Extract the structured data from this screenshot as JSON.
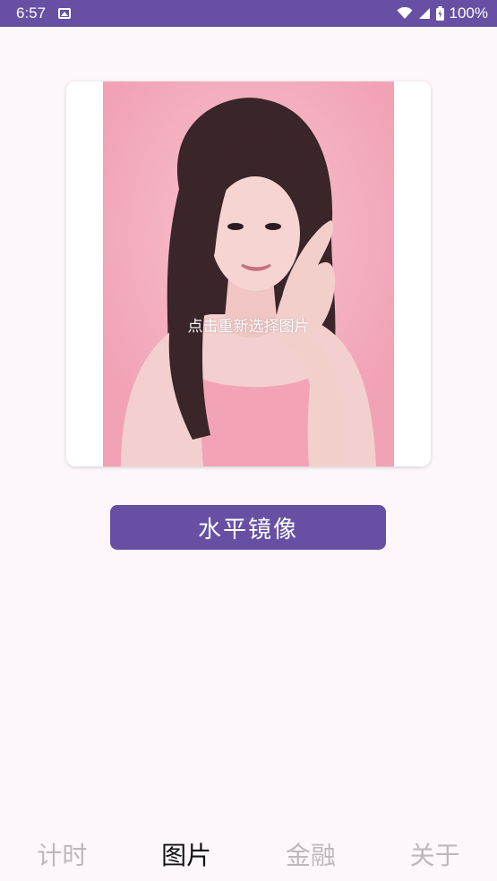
{
  "status_bar": {
    "time": "6:57",
    "battery": "100%"
  },
  "image_card": {
    "hint": "点击重新选择图片"
  },
  "mirror_button": {
    "label": "水平镜像"
  },
  "bottom_nav": {
    "items": [
      {
        "label": "计时",
        "active": false
      },
      {
        "label": "图片",
        "active": true
      },
      {
        "label": "金融",
        "active": false
      },
      {
        "label": "关于",
        "active": false
      }
    ]
  },
  "colors": {
    "primary": "#6750a4",
    "background": "#fdf7fb",
    "inactive_nav": "#bdb8bd"
  }
}
